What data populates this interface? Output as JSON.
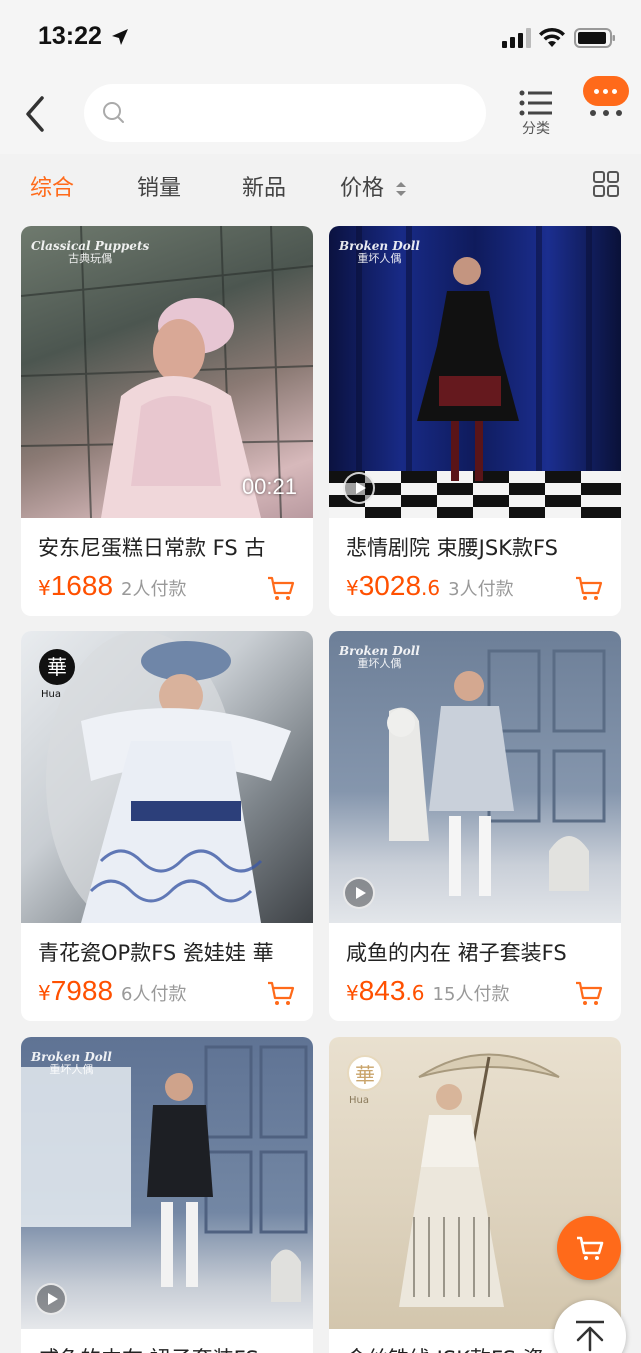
{
  "status_bar": {
    "time": "13:22"
  },
  "header": {
    "search_placeholder": "",
    "category_label": "分类"
  },
  "sort_tabs": [
    {
      "label": "综合",
      "active": true
    },
    {
      "label": "销量",
      "active": false
    },
    {
      "label": "新品",
      "active": false
    },
    {
      "label": "价格",
      "active": false
    }
  ],
  "products": [
    {
      "title": "安东尼蛋糕日常款 FS 古",
      "price_symbol": "¥",
      "price_int": "1688",
      "price_dec": "",
      "paid": "2人付款",
      "video_duration": "00:21",
      "brand": "Classical Puppets",
      "brand_cn": "古典玩偶"
    },
    {
      "title": "悲情剧院 束腰JSK款FS",
      "price_symbol": "¥",
      "price_int": "3028",
      "price_dec": ".6",
      "paid": "3人付款",
      "brand": "Broken Doll",
      "brand_cn": "重坏人偶"
    },
    {
      "title": "青花瓷OP款FS  瓷娃娃 華",
      "price_symbol": "¥",
      "price_int": "7988",
      "price_dec": "",
      "paid": "6人付款",
      "brand": "華",
      "brand_cn": "Hua"
    },
    {
      "title": "咸鱼的内在 裙子套装FS",
      "price_symbol": "¥",
      "price_int": "843",
      "price_dec": ".6",
      "paid": "15人付款",
      "brand": "Broken Doll",
      "brand_cn": "重坏人偶"
    },
    {
      "title": "咸鱼的内在 裙子套装FS",
      "price_symbol": "¥",
      "price_int": "",
      "price_dec": "",
      "paid": "",
      "brand": "Broken Doll",
      "brand_cn": "重坏人偶"
    },
    {
      "title": "金丝铁线 JSK款FS 瓷",
      "price_symbol": "¥",
      "price_int": "",
      "price_dec": "",
      "paid": "",
      "brand": "華",
      "brand_cn": "Hua"
    }
  ],
  "colors": {
    "accent": "#ff6a1a",
    "price": "#ff5000",
    "background": "#f2f2f2"
  },
  "icons": [
    "back-icon",
    "search-icon",
    "list-icon",
    "more-icon",
    "sort-arrows-icon",
    "grid-icon",
    "cart-icon",
    "video-play-icon",
    "scroll-top-icon"
  ]
}
